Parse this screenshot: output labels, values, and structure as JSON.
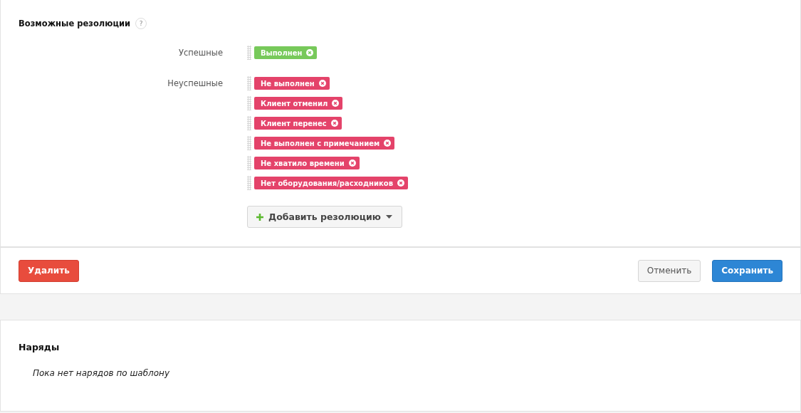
{
  "resolutions": {
    "title": "Возможные резолюции",
    "help": "?",
    "groups": [
      {
        "label": "Успешные",
        "color": "#77c95a",
        "tags": [
          "Выполнен"
        ]
      },
      {
        "label": "Неуспешные",
        "color": "#e4436a",
        "tags": [
          "Не выполнен",
          "Клиент отменил",
          "Клиент перенес",
          "Не выполнен с примечанием",
          "Не хватило времени",
          "Нет оборудования/расходников"
        ]
      }
    ],
    "add_button": "Добавить резолюцию"
  },
  "footer": {
    "delete": "Удалить",
    "cancel": "Отменить",
    "save": "Сохранить"
  },
  "orders": {
    "title": "Наряды",
    "empty": "Пока нет нарядов по шаблону"
  }
}
